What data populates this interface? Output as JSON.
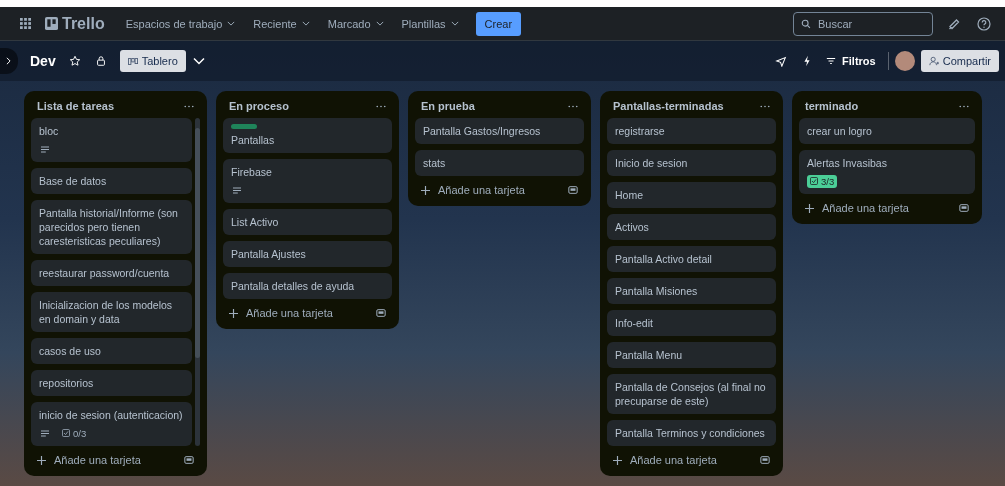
{
  "top_bar": {
    "logo": "Trello",
    "menus": [
      {
        "label": "Espacios de trabajo"
      },
      {
        "label": "Reciente"
      },
      {
        "label": "Marcado"
      },
      {
        "label": "Plantillas"
      }
    ],
    "create_button": "Crear",
    "search": {
      "placeholder": "Buscar"
    }
  },
  "board_bar": {
    "title": "Dev",
    "view_button": "Tablero",
    "filters": "Filtros",
    "share_button": "Compartir"
  },
  "lists": [
    {
      "title": "Lista de tareas",
      "add_card": "Añade una tarjeta",
      "scrollable": true,
      "cards": [
        {
          "title": "bloc",
          "has_description": true
        },
        {
          "title": "Base de datos",
          "has_description": false
        },
        {
          "title": "Pantalla historial/Informe (son parecidos pero tienen caresteristicas peculiares)",
          "has_description": false
        },
        {
          "title": "reestaurar password/cuenta",
          "has_description": false
        },
        {
          "title": "Inicializacion de los modelos en domain y data",
          "has_description": false
        },
        {
          "title": "casos de uso",
          "has_description": false
        },
        {
          "title": "repositorios",
          "has_description": false
        },
        {
          "title": "inicio de sesion (autenticacion)",
          "has_description": true,
          "checklist": {
            "text": "0/3",
            "complete": false
          }
        }
      ]
    },
    {
      "title": "En proceso",
      "add_card": "Añade una tarjeta",
      "scrollable": false,
      "cards": [
        {
          "title": "Pantallas",
          "has_description": false,
          "labels": [
            {
              "color": "#1f845a"
            }
          ]
        },
        {
          "title": "Firebase",
          "has_description": true
        },
        {
          "title": "List Activo",
          "has_description": false
        },
        {
          "title": "Pantalla Ajustes",
          "has_description": false
        },
        {
          "title": "Pantalla detalles de ayuda",
          "has_description": false
        }
      ]
    },
    {
      "title": "En prueba",
      "add_card": "Añade una tarjeta",
      "scrollable": false,
      "cards": [
        {
          "title": "Pantalla Gastos/Ingresos",
          "has_description": false
        },
        {
          "title": "stats",
          "has_description": false
        }
      ]
    },
    {
      "title": "Pantallas-terminadas",
      "add_card": "Añade una tarjeta",
      "scrollable": false,
      "cards": [
        {
          "title": "registrarse",
          "has_description": false
        },
        {
          "title": "Inicio de sesion",
          "has_description": false
        },
        {
          "title": "Home",
          "has_description": false
        },
        {
          "title": "Activos",
          "has_description": false
        },
        {
          "title": "Pantalla Activo detail",
          "has_description": false
        },
        {
          "title": "Pantalla Misiones",
          "has_description": false
        },
        {
          "title": "Info-edit",
          "has_description": false
        },
        {
          "title": "Pantalla Menu",
          "has_description": false
        },
        {
          "title": "Pantalla de Consejos (al final no precuparse de este)",
          "has_description": false
        },
        {
          "title": "Pantalla Terminos y condiciones",
          "has_description": false
        }
      ]
    },
    {
      "title": "terminado",
      "add_card": "Añade una tarjeta",
      "scrollable": false,
      "cards": [
        {
          "title": "crear un logro",
          "has_description": false
        },
        {
          "title": "Alertas Invasibas",
          "has_description": false,
          "checklist": {
            "text": "3/3",
            "complete": true
          }
        }
      ]
    }
  ]
}
